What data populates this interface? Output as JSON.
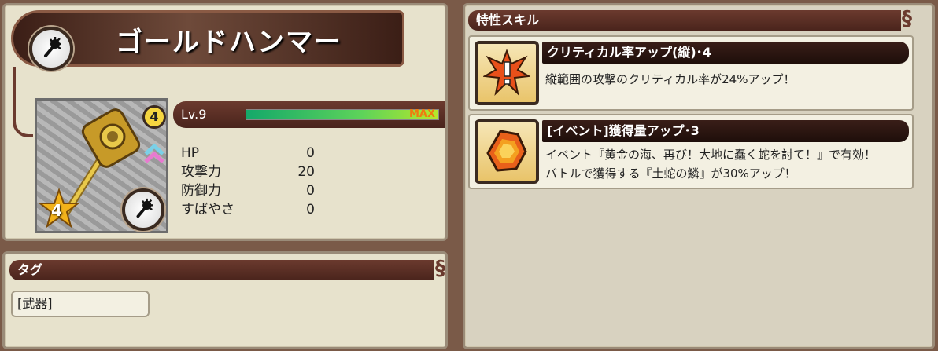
{
  "item": {
    "name": "ゴールドハンマー",
    "rarity": "4",
    "stars": "4",
    "level_label": "Lv.9",
    "level_max_label": "MAX",
    "level_progress": 1.0,
    "weapon_type_icon": "mace-icon",
    "stats": [
      {
        "label": "HP",
        "value": "0"
      },
      {
        "label": "攻撃力",
        "value": "20"
      },
      {
        "label": "防御力",
        "value": "0"
      },
      {
        "label": "すばやさ",
        "value": "0"
      }
    ]
  },
  "tag": {
    "header": "タグ",
    "items": [
      "[武器]"
    ]
  },
  "skills": {
    "header": "特性スキル",
    "list": [
      {
        "name": "クリティカル率アップ(縦)･4",
        "icon": "critical-burst-icon",
        "desc": [
          "縦範囲の攻撃のクリティカル率が24%アップ！"
        ]
      },
      {
        "name": "[イベント]獲得量アップ･3",
        "icon": "scale-gem-icon",
        "desc": [
          "イベント『黄金の海、再び！大地に蠢く蛇を討て！』で有効！",
          "バトルで獲得する『土蛇の鱗』が30%アップ！"
        ]
      }
    ]
  },
  "colors": {
    "header_bar": "#4a241c",
    "panel_bg": "#e7e2cc",
    "gauge_start": "#14a86a",
    "gauge_end": "#b7e82a",
    "max_label": "#f07a10"
  }
}
